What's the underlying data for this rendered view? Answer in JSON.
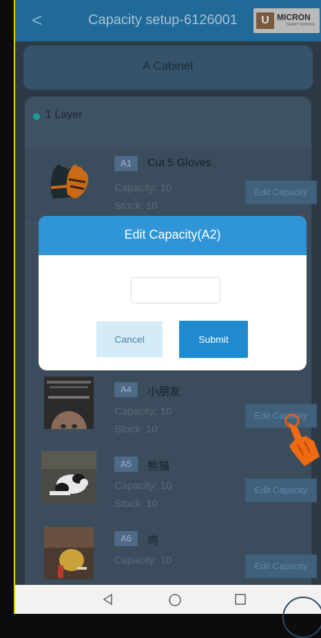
{
  "header": {
    "back_glyph": "<",
    "title": "Capacity setup-6126001",
    "logo_mark": "U",
    "logo_text": "MICRON",
    "logo_sub": "SMART VENDING"
  },
  "cabinet": {
    "title": "A Cabinet"
  },
  "layer": {
    "label": "1 Layer"
  },
  "slots": [
    {
      "code": "A1",
      "name": "Cut 5 Gloves",
      "capacity": "Capacity:  10",
      "stock": "Stock:  10",
      "edit_label": "Edit Capacity"
    },
    {
      "code": "A4",
      "name": "小朋友",
      "capacity": "Capacity:  10",
      "stock": "Stock:  10",
      "edit_label": "Edit Capacity"
    },
    {
      "code": "A5",
      "name": "熊猫",
      "capacity": "Capacity:  10",
      "stock": "Stock:  10",
      "edit_label": "Edit Capacity"
    },
    {
      "code": "A6",
      "name": "鸡",
      "capacity": "Capacity:  10",
      "stock": "",
      "edit_label": "Edit Capacity"
    }
  ],
  "modal": {
    "title": "Edit Capacity(A2)",
    "input_value": "",
    "cancel_label": "Cancel",
    "submit_label": "Submit"
  },
  "colors": {
    "header": "#1f6a98",
    "modal_header": "#2f95d6",
    "submit": "#1f8ad0",
    "cancel": "#d4ecf7",
    "yellow_edge": "#e8d400"
  },
  "icons": {
    "nav_back": "triangle-back-icon",
    "nav_home": "circle-home-icon",
    "nav_recent": "square-recent-icon",
    "tap_hand": "hand-pointer-icon"
  }
}
